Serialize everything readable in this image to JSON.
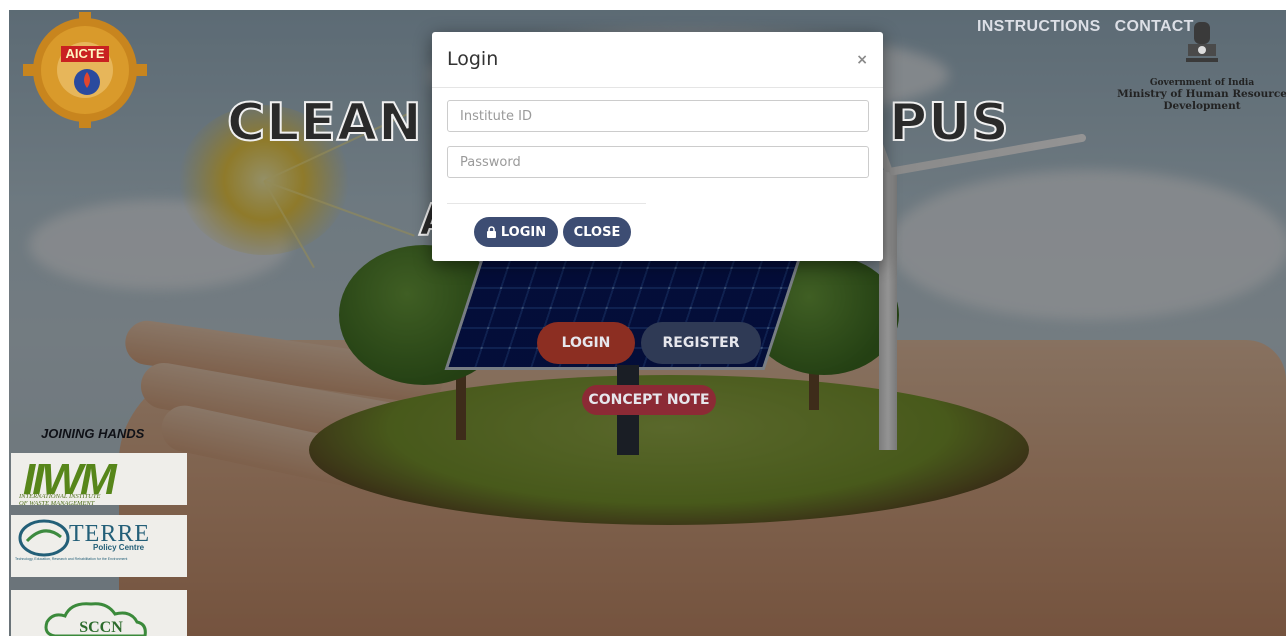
{
  "header": {
    "nav": [
      {
        "label": "INSTRUCTIONS"
      },
      {
        "label": "CONTACT"
      }
    ],
    "gov": {
      "line1": "Government of India",
      "line2": "Ministry of Human Resource",
      "line3": "Development"
    },
    "aicte_logo_text": "AICTE"
  },
  "hero": {
    "title_left": "CLEAN",
    "title_right": "PUS",
    "title_under": "A"
  },
  "actions": {
    "login": "LOGIN",
    "register": "REGISTER",
    "concept_note": "CONCEPT NOTE"
  },
  "partners": {
    "heading": "JOINING HANDS",
    "iiwm": {
      "name": "IIWM",
      "sub1": "INTERNATIONAL INSTITUTE",
      "sub2": "OF WASTE MANAGEMENT"
    },
    "terre": {
      "name": "TERRE",
      "sub": "Policy Centre",
      "tagline": "Technology, Education, Research and Rehabilitation for the Environment"
    },
    "sccn": {
      "name": "SCCN"
    }
  },
  "modal": {
    "title": "Login",
    "close_symbol": "×",
    "institute_placeholder": "Institute ID",
    "password_placeholder": "Password",
    "login_label": "LOGIN",
    "close_label": "CLOSE"
  },
  "colors": {
    "primary_button": "#3d4d73",
    "login_hero": "#8c2e22",
    "register_hero": "#2f3a55",
    "concept_note": "#8c2a35"
  }
}
